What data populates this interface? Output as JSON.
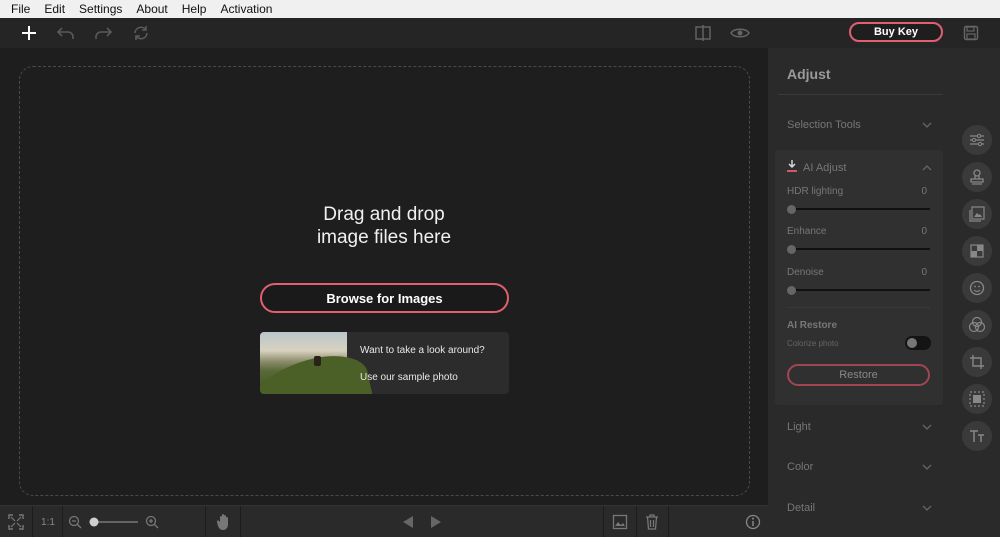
{
  "menu": [
    "File",
    "Edit",
    "Settings",
    "About",
    "Help",
    "Activation"
  ],
  "toolbar": {
    "buy_key": "Buy Key",
    "icons": [
      "add-icon",
      "undo-icon",
      "redo-icon",
      "reset-icon",
      "compare-icon",
      "preview-eye-icon",
      "save-icon"
    ]
  },
  "canvas": {
    "drop_line1": "Drag and drop",
    "drop_line2": "image files here",
    "browse_label": "Browse for Images",
    "sample_line1": "Want to take a look around?",
    "sample_line2": "Use our sample photo"
  },
  "bottombar": {
    "zoom_1to1": "1:1",
    "icons": [
      "fit-screen-icon",
      "zoom-out-icon",
      "zoom-in-icon",
      "hand-icon",
      "prev-arrow-icon",
      "next-arrow-icon",
      "image-icon",
      "trash-icon",
      "info-icon"
    ],
    "zoom_level": 0
  },
  "panel": {
    "title": "Adjust",
    "selection_tools": "Selection Tools",
    "ai_adjust": "AI Adjust",
    "sliders": [
      {
        "label": "HDR lighting",
        "value": "0"
      },
      {
        "label": "Enhance",
        "value": "0"
      },
      {
        "label": "Denoise",
        "value": "0"
      }
    ],
    "ai_restore": "AI Restore",
    "colorize": "Colorize photo",
    "colorize_on": false,
    "restore_button": "Restore",
    "light": "Light",
    "color": "Color",
    "detail": "Detail"
  },
  "side_tools": [
    "adjust-sliders-icon",
    "stamp-icon",
    "image-layers-icon",
    "grid-icon",
    "face-icon",
    "color-circles-icon",
    "crop-icon",
    "select-icon",
    "text-icon"
  ],
  "colors": {
    "accent": "#e06070",
    "panel_bg": "#2a2a2a",
    "canvas_bg": "#1e1e1e"
  }
}
